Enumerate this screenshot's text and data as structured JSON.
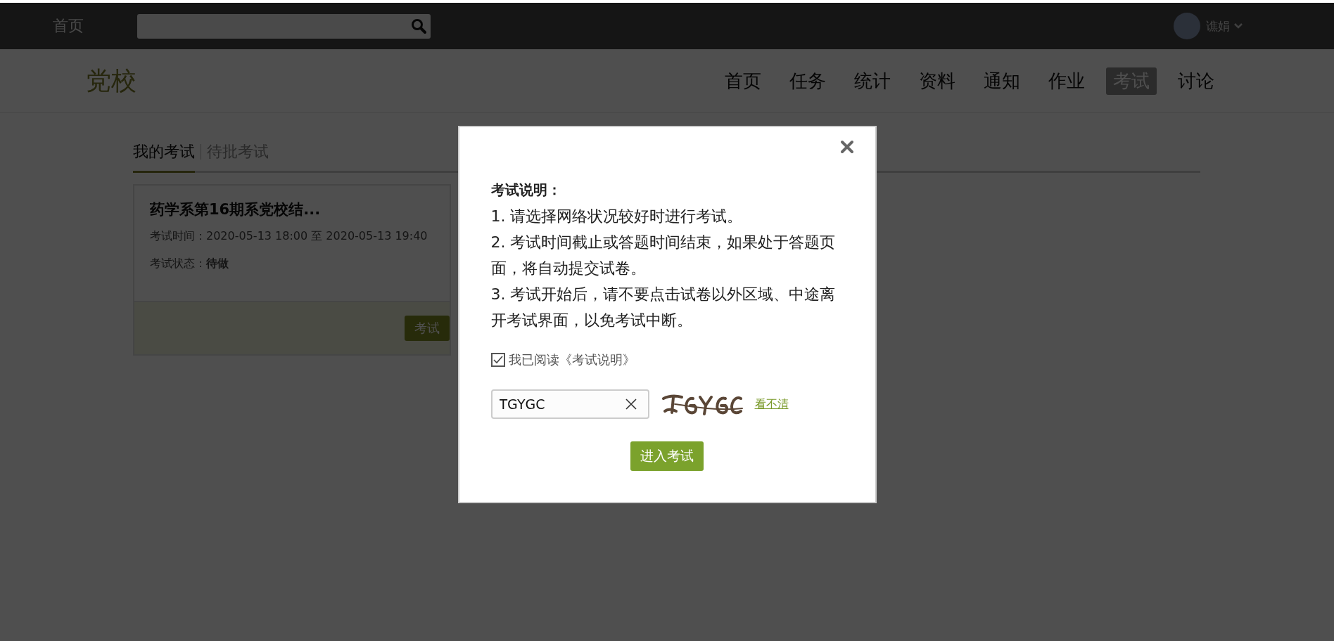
{
  "top_bar": {
    "home_link": "首页",
    "user": {
      "name": "谯娟"
    }
  },
  "site": {
    "title": "党校",
    "nav": [
      {
        "label": "首页",
        "selected": false
      },
      {
        "label": "任务",
        "selected": false
      },
      {
        "label": "统计",
        "selected": false
      },
      {
        "label": "资料",
        "selected": false
      },
      {
        "label": "通知",
        "selected": false
      },
      {
        "label": "作业",
        "selected": false
      },
      {
        "label": "考试",
        "selected": true
      },
      {
        "label": "讨论",
        "selected": false
      }
    ]
  },
  "tabs": [
    {
      "label": "我的考试",
      "selected": true
    },
    {
      "label": "待批考试",
      "selected": false
    }
  ],
  "exams": [
    {
      "title": "药学系第16期系党校结...",
      "time": "考试时间：2020-05-13 18:00 至 2020-05-13 19:40",
      "status": "考试状态：**待做**",
      "button": "考试"
    }
  ],
  "dialog": {
    "heading": "考试说明：",
    "items": [
      "1. 请选择网络状况较好时进行考试。",
      "2. 考试时间截止或答题时间结束，如果处于答题页面，将自动提交试卷。",
      "3. 考试开始后，请不要点击试卷以外区域、中途离开考试界面，以免考试中断。"
    ],
    "agreement": {
      "label": "我已阅读《考试说明》",
      "checked": true
    },
    "captcha": {
      "value": "TGYGC",
      "refresh_link": "看不清"
    },
    "submit": "进入考试"
  }
}
